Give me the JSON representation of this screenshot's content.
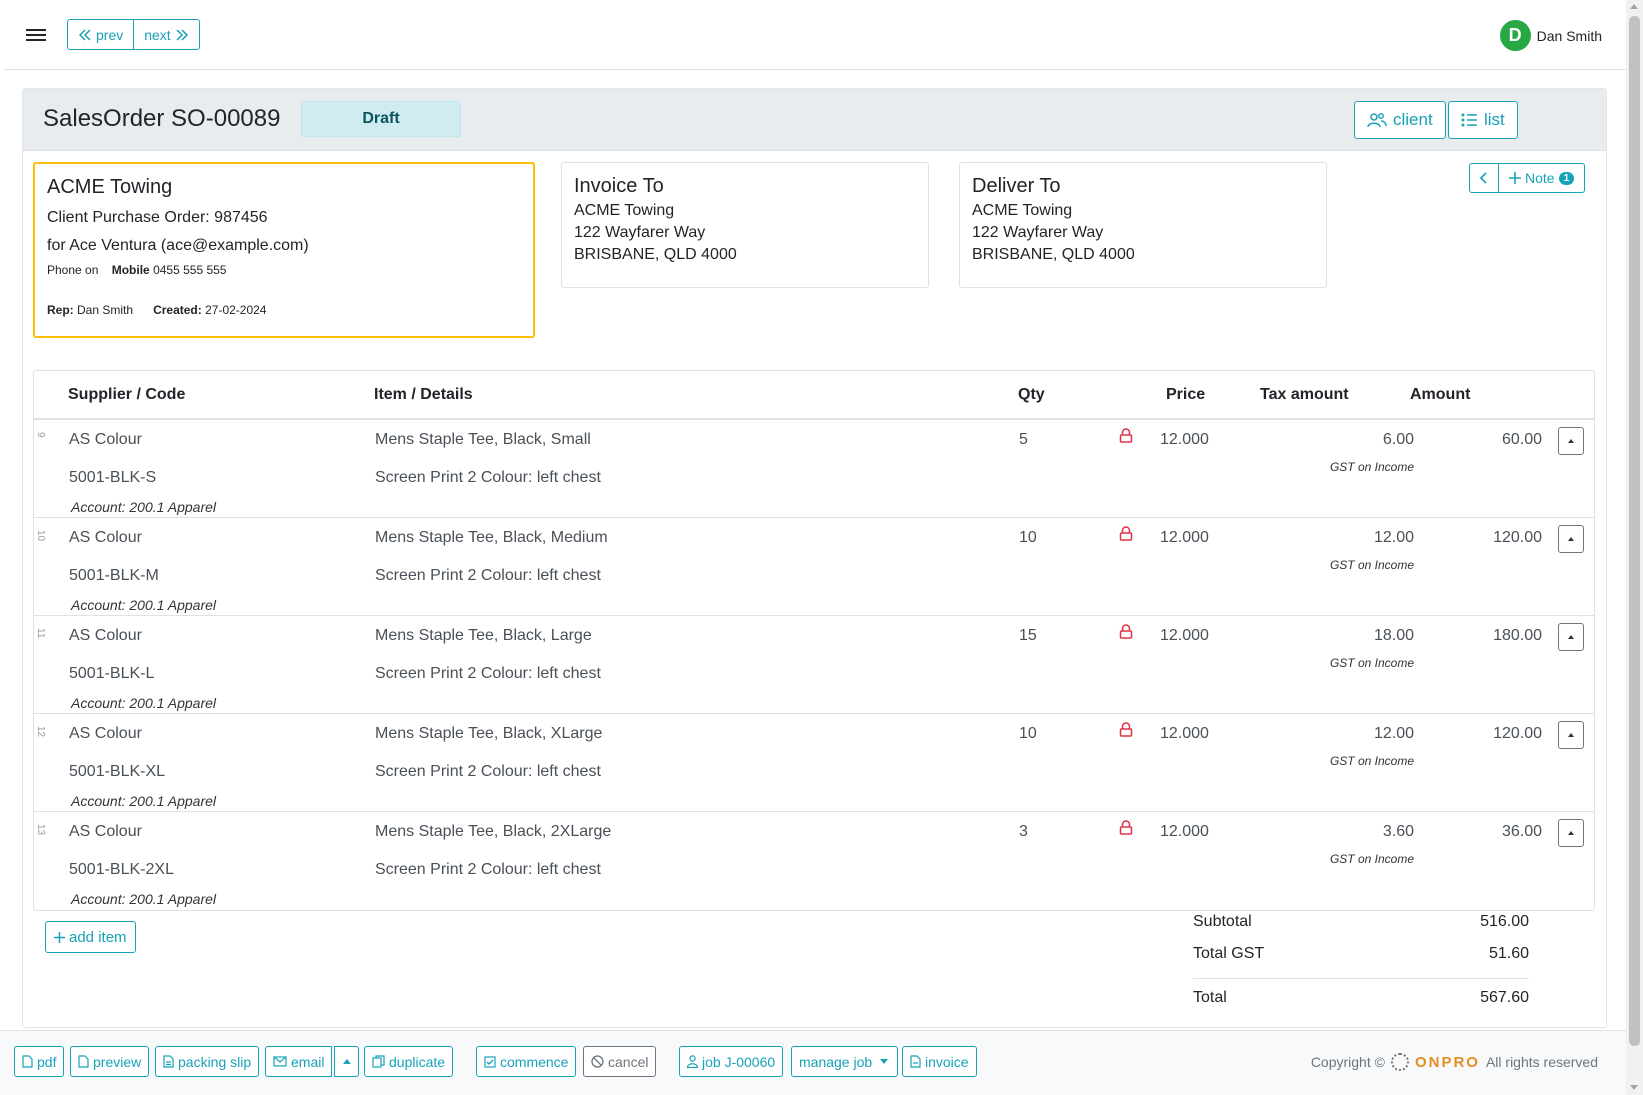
{
  "topbar": {
    "prev_label": "prev",
    "next_label": "next",
    "user_initial": "D",
    "user_name": "Dan Smith"
  },
  "header": {
    "title": "SalesOrder SO-00089",
    "status": "Draft",
    "client_button": "client",
    "list_button": "list"
  },
  "client": {
    "name": "ACME Towing",
    "purchase_order": "Client Purchase Order: 987456",
    "contact": "for Ace Ventura (ace@example.com)",
    "phone_label": "Phone on",
    "mobile_label": "Mobile",
    "mobile_value": "0455 555 555",
    "rep_label": "Rep:",
    "rep_value": "Dan Smith",
    "created_label": "Created:",
    "created_value": "27-02-2024"
  },
  "invoice_to": {
    "heading": "Invoice To",
    "lines": [
      "ACME Towing",
      "122 Wayfarer Way",
      "BRISBANE, QLD 4000"
    ]
  },
  "deliver_to": {
    "heading": "Deliver To",
    "lines": [
      "ACME Towing",
      "122 Wayfarer Way",
      "BRISBANE, QLD 4000"
    ]
  },
  "note": {
    "label": "Note",
    "count": "1"
  },
  "table": {
    "columns": [
      "Supplier / Code",
      "Item / Details",
      "Qty",
      "Price",
      "Tax amount",
      "Amount"
    ],
    "rows": [
      {
        "idx": "9",
        "supplier": "AS Colour",
        "code": "5001-BLK-S",
        "account": "Account: 200.1 Apparel",
        "item": "Mens Staple Tee, Black, Small",
        "details": "Screen Print 2 Colour: left chest",
        "qty": "5",
        "price": "12.000",
        "tax": "6.00",
        "tax_label": "GST on Income",
        "amount": "60.00"
      },
      {
        "idx": "10",
        "supplier": "AS Colour",
        "code": "5001-BLK-M",
        "account": "Account: 200.1 Apparel",
        "item": "Mens Staple Tee, Black, Medium",
        "details": "Screen Print 2 Colour: left chest",
        "qty": "10",
        "price": "12.000",
        "tax": "12.00",
        "tax_label": "GST on Income",
        "amount": "120.00"
      },
      {
        "idx": "11",
        "supplier": "AS Colour",
        "code": "5001-BLK-L",
        "account": "Account: 200.1 Apparel",
        "item": "Mens Staple Tee, Black, Large",
        "details": "Screen Print 2 Colour: left chest",
        "qty": "15",
        "price": "12.000",
        "tax": "18.00",
        "tax_label": "GST on Income",
        "amount": "180.00"
      },
      {
        "idx": "12",
        "supplier": "AS Colour",
        "code": "5001-BLK-XL",
        "account": "Account: 200.1 Apparel",
        "item": "Mens Staple Tee, Black, XLarge",
        "details": "Screen Print 2 Colour: left chest",
        "qty": "10",
        "price": "12.000",
        "tax": "12.00",
        "tax_label": "GST on Income",
        "amount": "120.00"
      },
      {
        "idx": "13",
        "supplier": "AS Colour",
        "code": "5001-BLK-2XL",
        "account": "Account: 200.1 Apparel",
        "item": "Mens Staple Tee, Black, 2XLarge",
        "details": "Screen Print 2 Colour: left chest",
        "qty": "3",
        "price": "12.000",
        "tax": "3.60",
        "tax_label": "GST on Income",
        "amount": "36.00"
      }
    ]
  },
  "add_item_label": "add item",
  "totals": {
    "subtotal_label": "Subtotal",
    "subtotal_value": "516.00",
    "gst_label": "Total GST",
    "gst_value": "51.60",
    "total_label": "Total",
    "total_value": "567.60"
  },
  "footer": {
    "pdf": "pdf",
    "preview": "preview",
    "packing_slip": "packing slip",
    "email": "email",
    "duplicate": "duplicate",
    "commence": "commence",
    "cancel": "cancel",
    "job": "job J-00060",
    "manage_job": "manage job",
    "invoice": "invoice",
    "copyright_prefix": "Copyright ©",
    "brand": "ONPRO",
    "copyright_suffix": "All rights reserved"
  },
  "colors": {
    "accent": "#17a2b8",
    "status_bg": "#d1ecf1",
    "client_border": "#ffc107",
    "lock": "#dc3545",
    "avatar": "#28a745",
    "brand": "#e58e26"
  }
}
